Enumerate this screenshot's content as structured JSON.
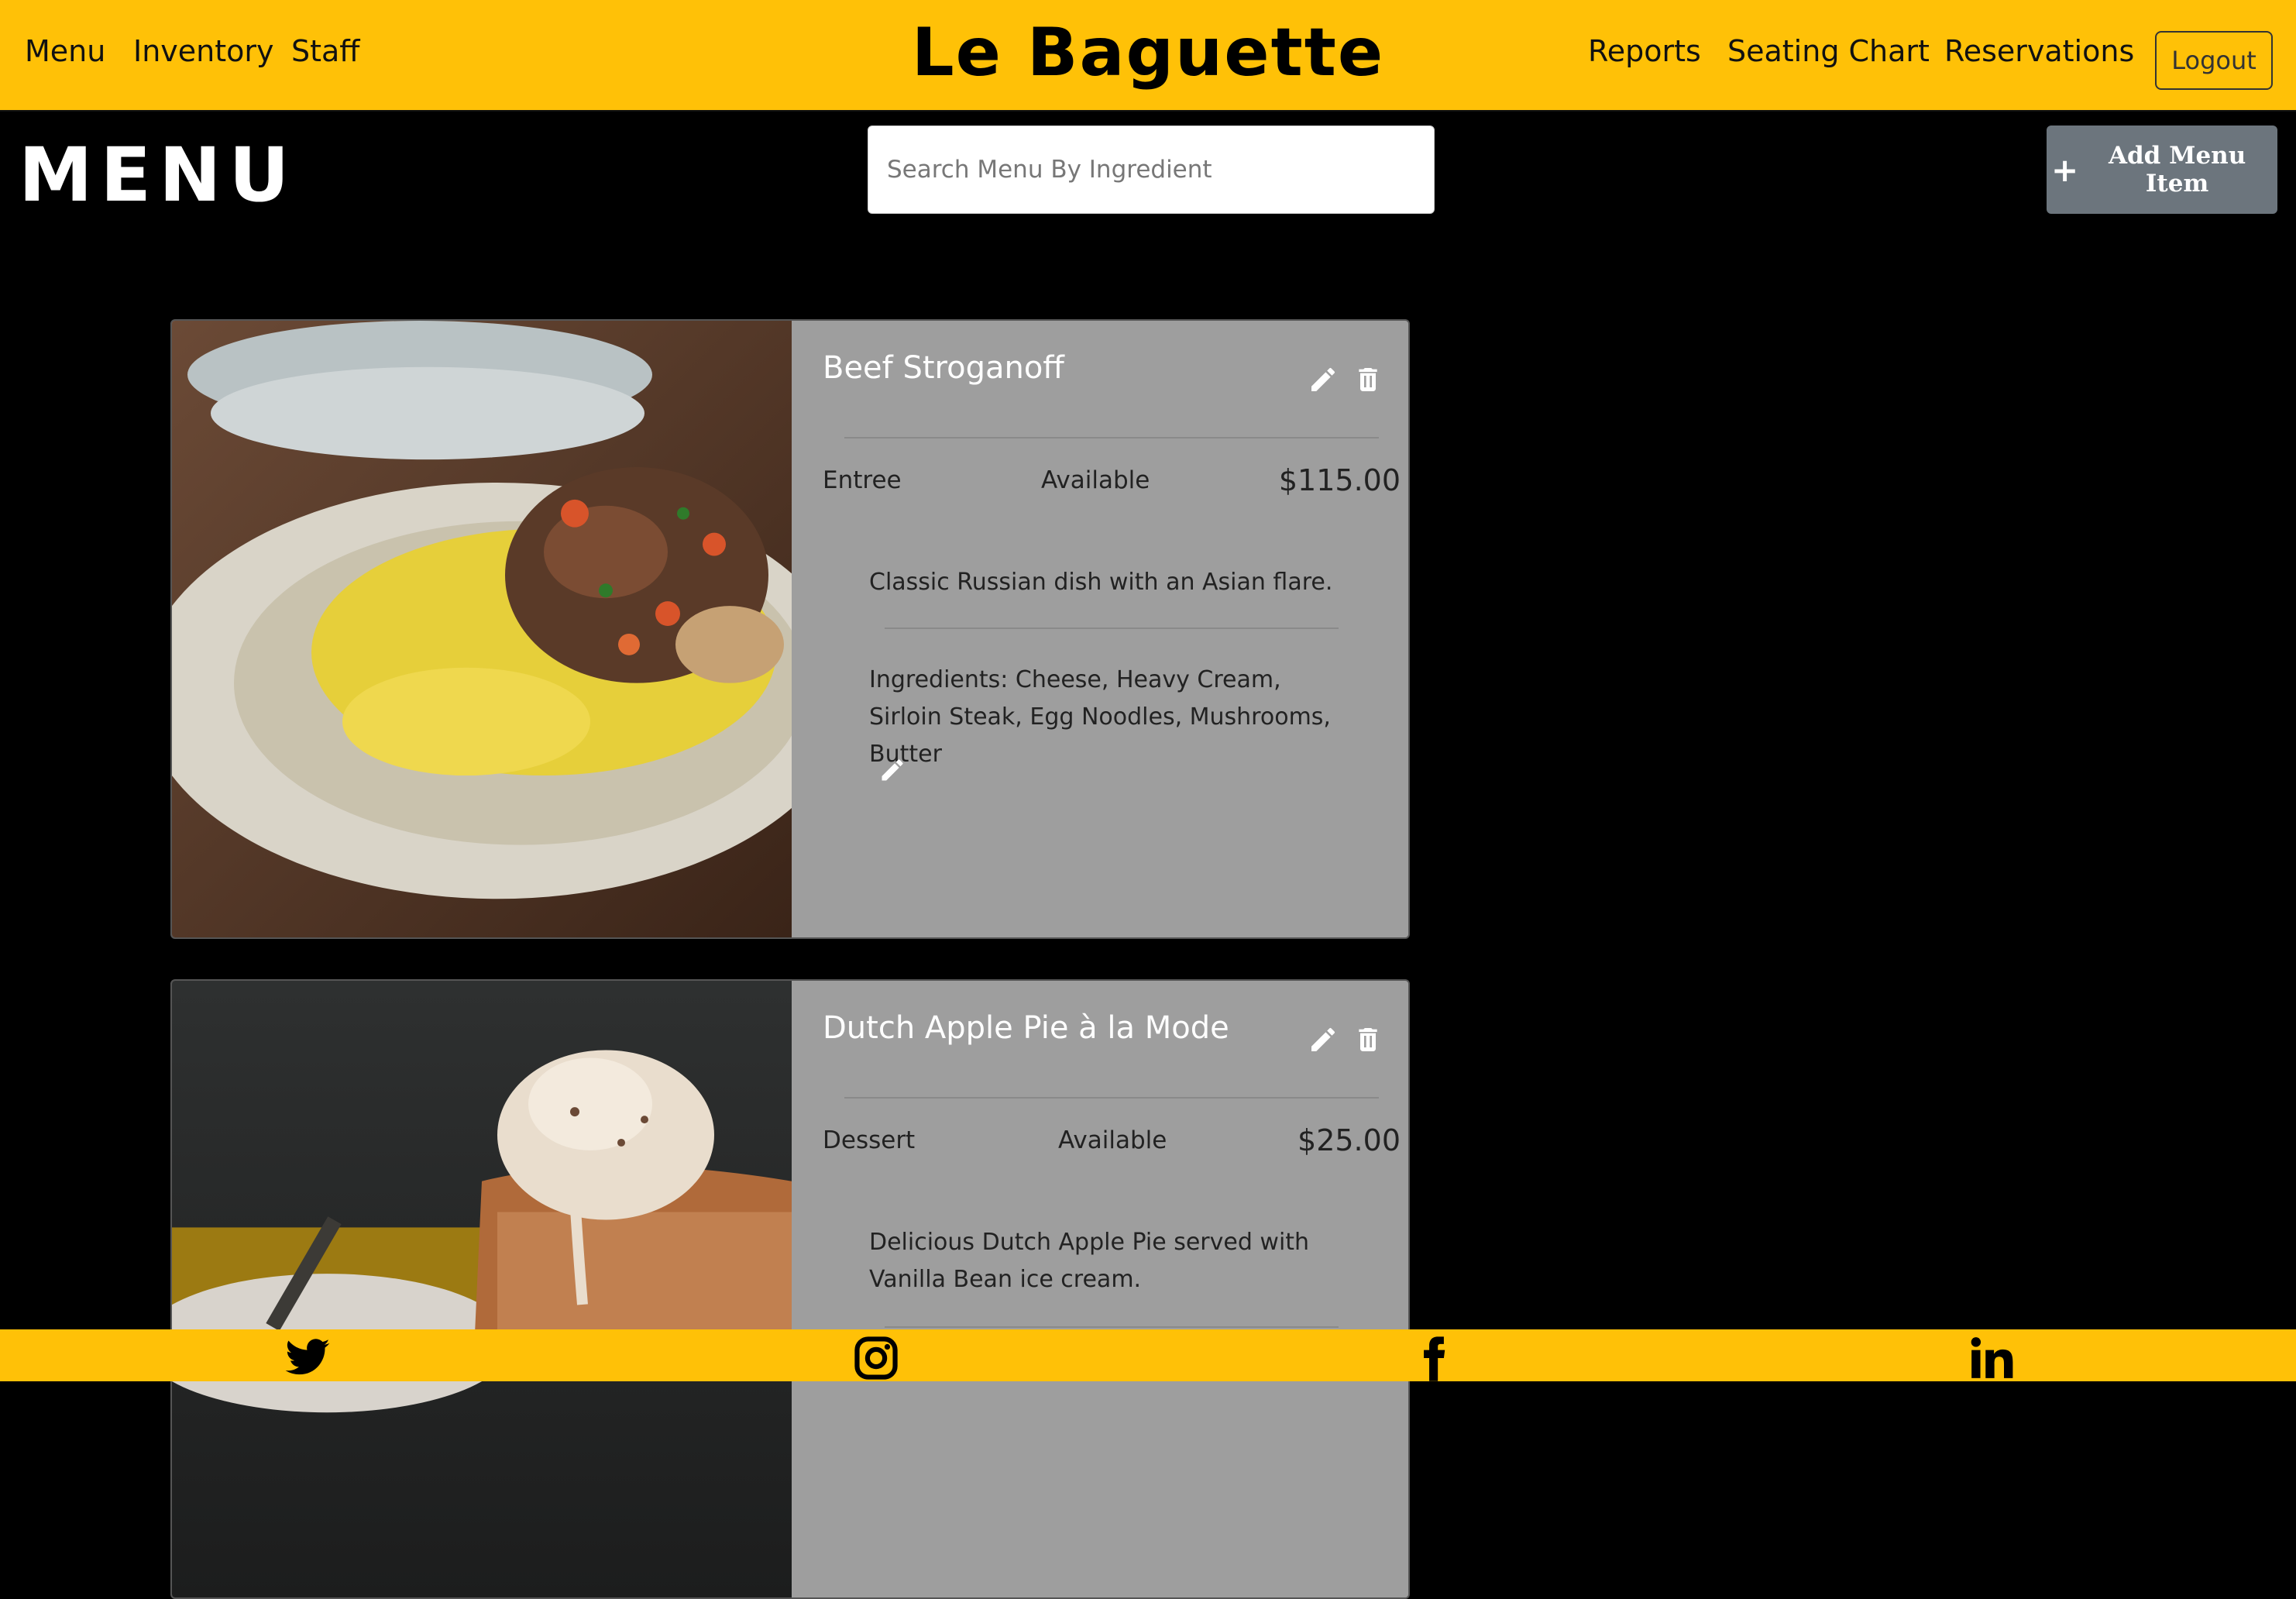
{
  "nav": {
    "left": [
      "Menu",
      "Inventory",
      "Staff"
    ],
    "brand": "Le Baguette",
    "right": [
      "Reports",
      "Seating Chart",
      "Reservations"
    ],
    "logout": "Logout"
  },
  "header": {
    "title": "MENU",
    "search_placeholder": "Search Menu By Ingredient",
    "add_button": "Add Menu Item"
  },
  "items": [
    {
      "name": "Beef Stroganoff",
      "category": "Entree",
      "status": "Available",
      "price": "$115.00",
      "description": "Classic Russian dish with an Asian flare.",
      "ingredients": "Ingredients: Cheese, Heavy Cream, Sirloin Steak, Egg Noodles, Mushrooms, Butter"
    },
    {
      "name": "Dutch Apple Pie à la Mode",
      "category": "Dessert",
      "status": "Available",
      "price": "$25.00",
      "description": "Delicious Dutch Apple Pie served with Vanilla Bean ice cream."
    }
  ],
  "icons": {
    "edit": "pencil-icon",
    "delete": "trash-icon",
    "social": [
      "twitter-icon",
      "instagram-icon",
      "facebook-icon",
      "linkedin-icon"
    ]
  },
  "colors": {
    "accent": "#ffc107",
    "card": "#9e9e9e",
    "button": "#6c757d"
  }
}
